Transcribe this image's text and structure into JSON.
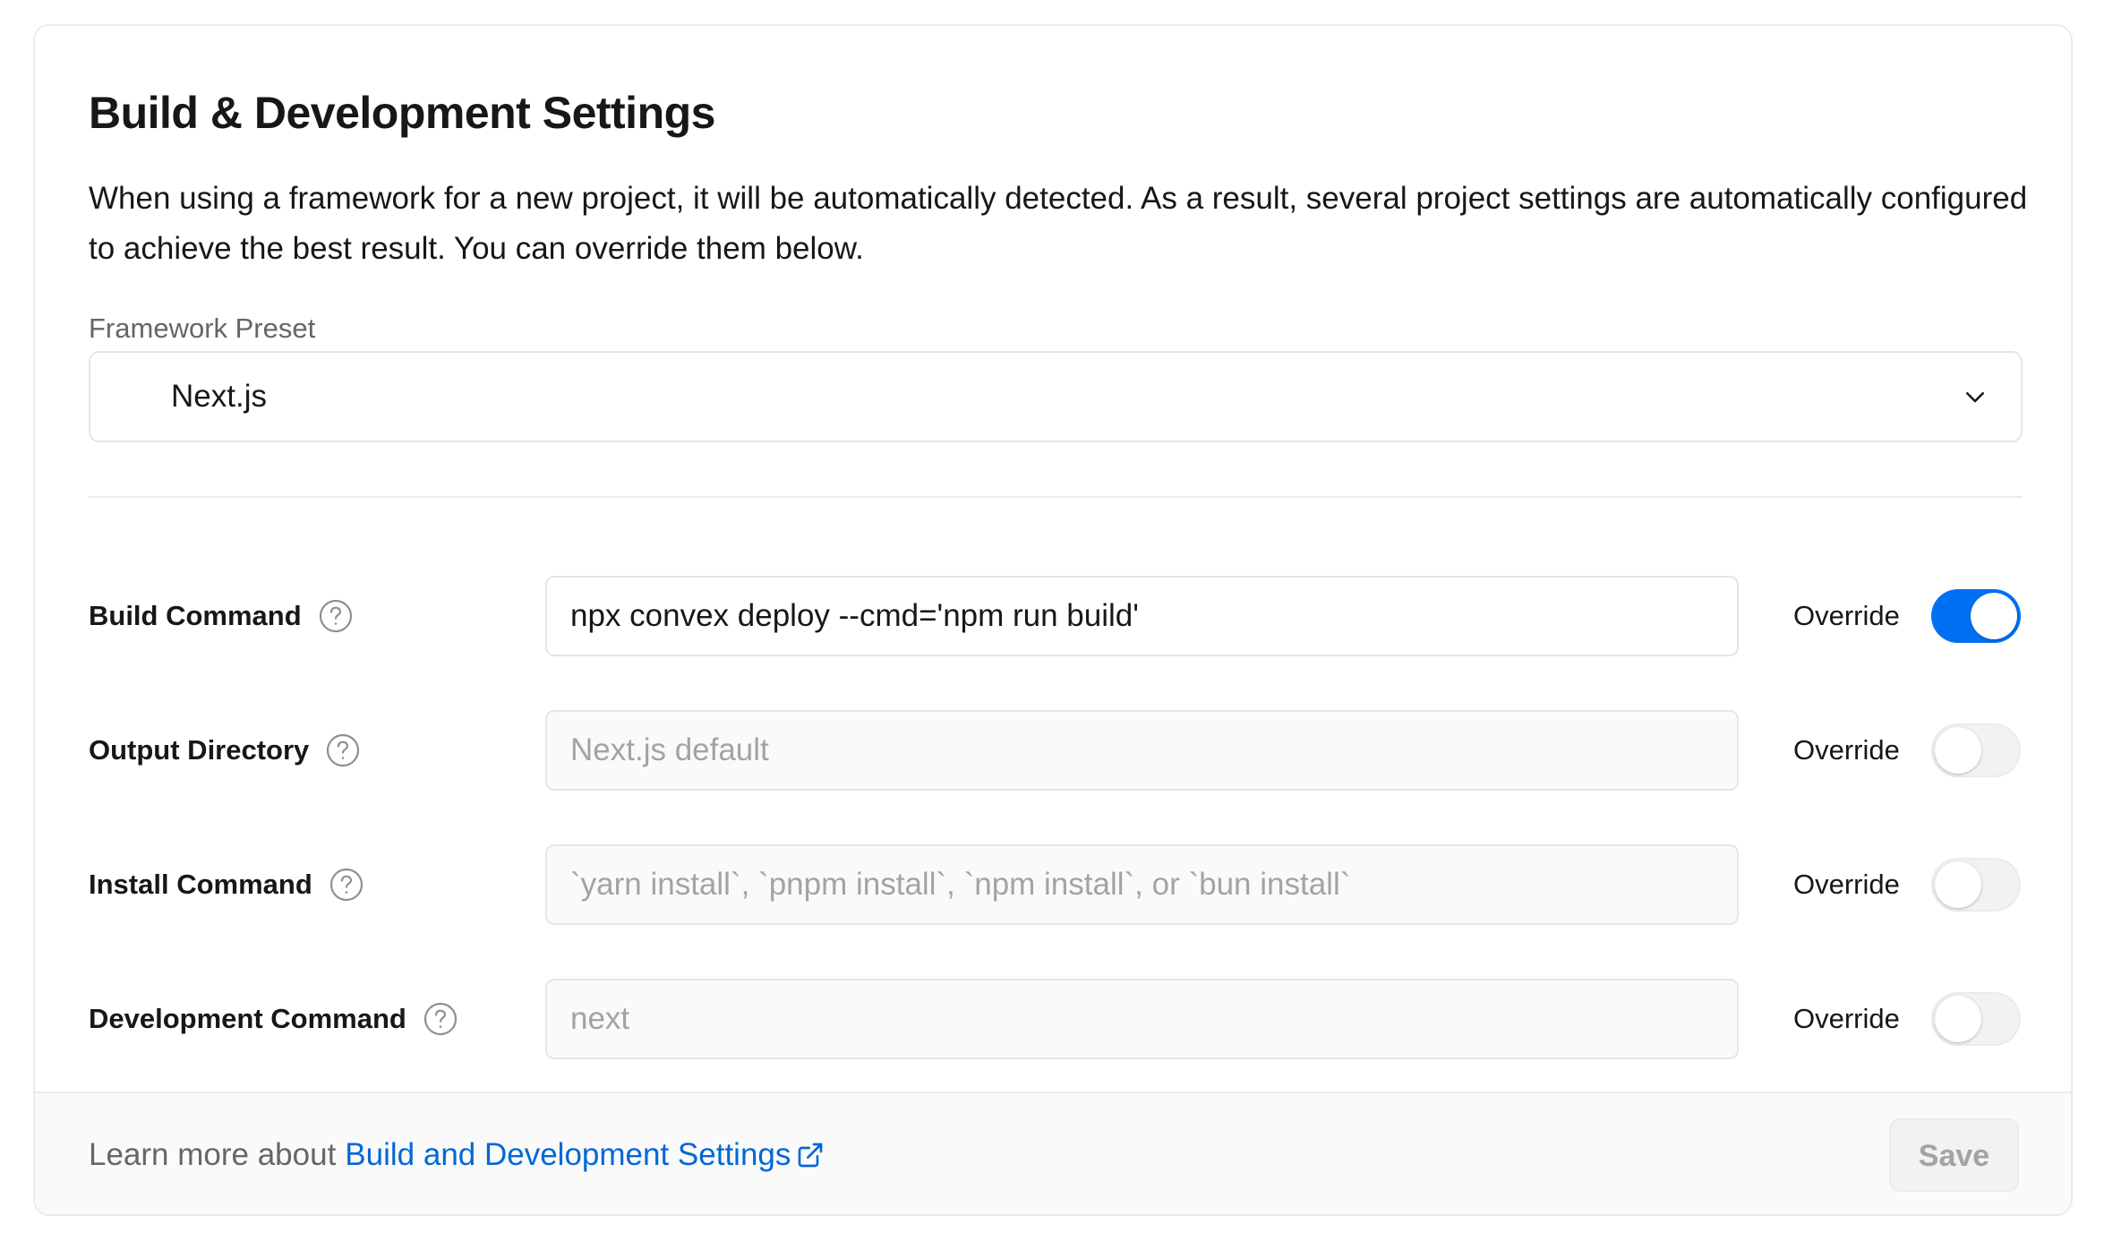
{
  "section": {
    "title": "Build & Development Settings",
    "description": "When using a framework for a new project, it will be automatically detected. As a result, several project settings are automatically configured to achieve the best result. You can override them below."
  },
  "framework_preset": {
    "label": "Framework Preset",
    "value": "Next.js"
  },
  "rows": [
    {
      "label": "Build Command",
      "value": "npx convex deploy --cmd='npm run build'",
      "placeholder": "",
      "override_label": "Override",
      "override_on": true
    },
    {
      "label": "Output Directory",
      "value": "",
      "placeholder": "Next.js default",
      "override_label": "Override",
      "override_on": false
    },
    {
      "label": "Install Command",
      "value": "",
      "placeholder": "`yarn install`, `pnpm install`, `npm install`, or `bun install`",
      "override_label": "Override",
      "override_on": false
    },
    {
      "label": "Development Command",
      "value": "",
      "placeholder": "next",
      "override_label": "Override",
      "override_on": false
    }
  ],
  "footer": {
    "prefix": "Learn more about",
    "link_label": "Build and Development Settings",
    "save_label": "Save"
  },
  "colors": {
    "accent": "#0070f3",
    "link": "#0068d6",
    "border": "#ebebeb"
  },
  "icons": {
    "help": "question-circle-icon",
    "chevron": "chevron-down-icon",
    "external": "external-link-icon"
  }
}
